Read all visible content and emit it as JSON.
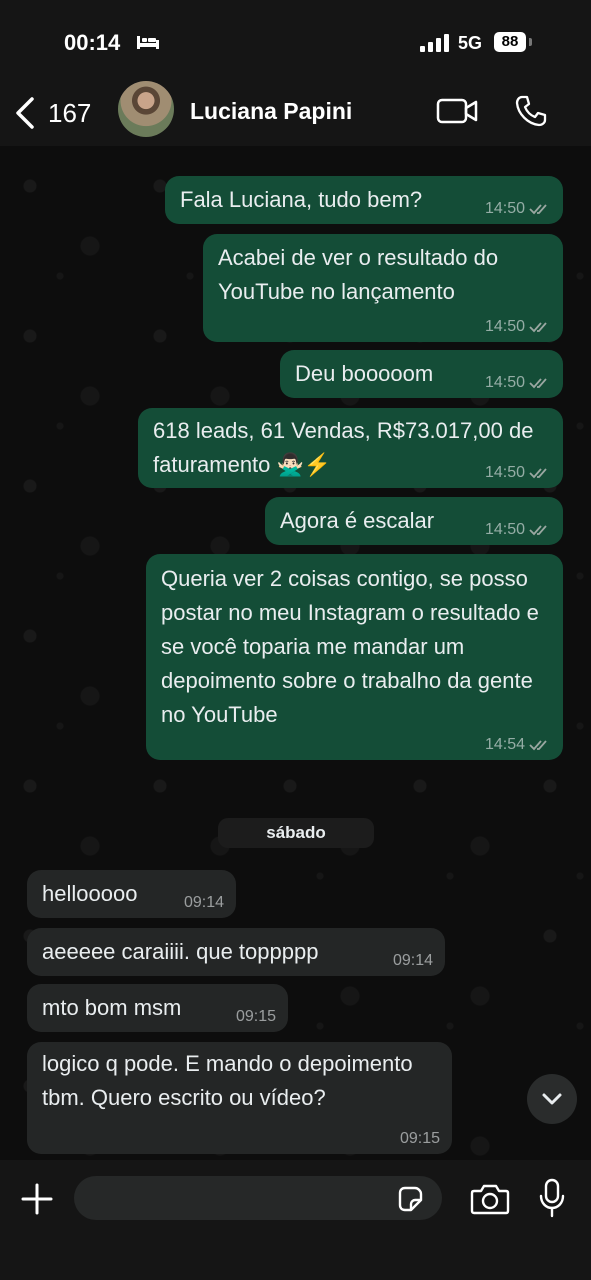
{
  "status_bar": {
    "time": "00:14",
    "network": "5G",
    "battery": "88"
  },
  "header": {
    "unread_count": "167",
    "contact_name": "Luciana Papini"
  },
  "day_separator": "sábado",
  "messages": [
    {
      "direction": "out",
      "text": "Fala Luciana, tudo bem?",
      "time": "14:50",
      "status": "read"
    },
    {
      "direction": "out",
      "text": "Acabei de ver o resultado do YouTube no lançamento",
      "time": "14:50",
      "status": "read"
    },
    {
      "direction": "out",
      "text": "Deu booooom",
      "time": "14:50",
      "status": "read"
    },
    {
      "direction": "out",
      "text": "618 leads, 61 Vendas, R$73.017,00 de faturamento 🙅🏻‍♂️⚡",
      "time": "14:50",
      "status": "read"
    },
    {
      "direction": "out",
      "text": "Agora é escalar",
      "time": "14:50",
      "status": "read"
    },
    {
      "direction": "out",
      "text": "Queria ver 2 coisas contigo, se posso postar no meu Instagram o resultado e se você toparia me mandar um depoimento sobre o trabalho da gente no YouTube",
      "time": "14:54",
      "status": "read"
    },
    {
      "direction": "in",
      "text": "hellooooo",
      "time": "09:14"
    },
    {
      "direction": "in",
      "text": "aeeeee caraiiii. que toppppp",
      "time": "09:14"
    },
    {
      "direction": "in",
      "text": "mto bom msm",
      "time": "09:15"
    },
    {
      "direction": "in",
      "text": "logico q pode. E mando o depoimento tbm. Quero escrito ou vídeo?",
      "time": "09:15"
    }
  ],
  "input": {
    "placeholder": "",
    "value": ""
  },
  "colors": {
    "outgoing_bubble": "#144d37",
    "incoming_bubble": "#242626",
    "background": "#0d0d0d"
  }
}
